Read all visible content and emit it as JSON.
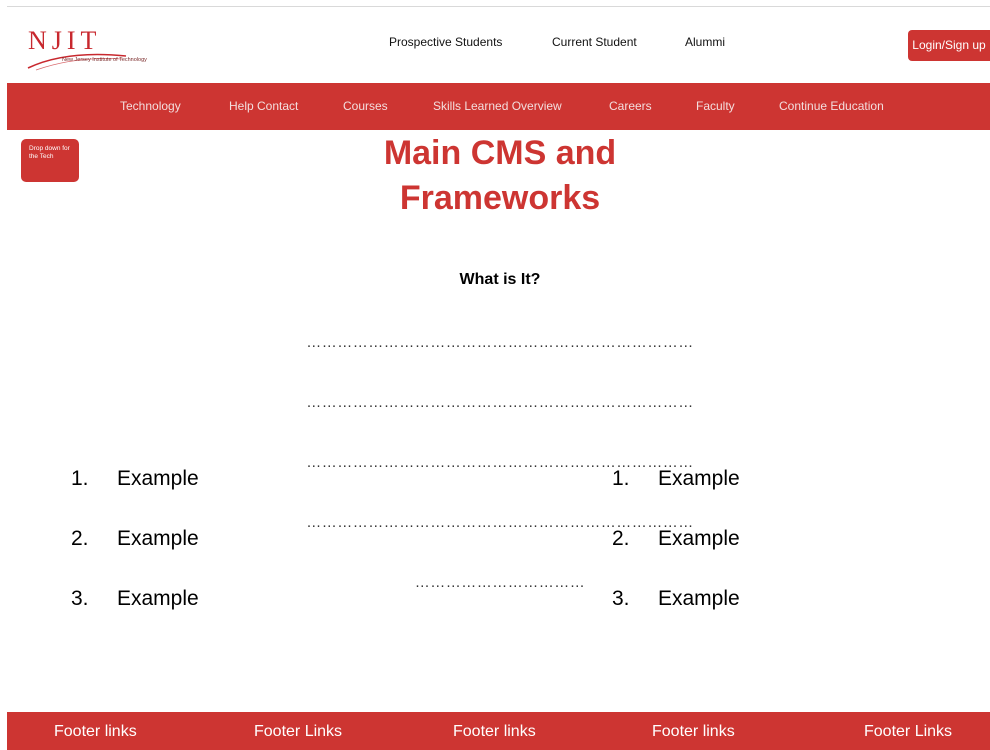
{
  "brand": {
    "logo_text": "NJIT",
    "tagline": "New Jersey Institute of Technology",
    "accent_color": "#cd3532"
  },
  "top_links": [
    "Prospective Students",
    "Current Student",
    "Alummi"
  ],
  "login_label": "Login/Sign up",
  "nav": {
    "items": [
      "Technology",
      "Help Contact",
      "Courses",
      "Skills Learned Overview",
      "Careers",
      "Faculty",
      "Continue Education"
    ]
  },
  "dropdown_label": "Drop down for the Tech",
  "page_title": "Main CMS and Frameworks",
  "section": {
    "heading": "What is It?",
    "placeholder_lines": [
      "…………………………………………………………………",
      "…………………………………………………………………",
      "…………………………………………………………………",
      "…………………………………………………………………",
      "……………………………"
    ]
  },
  "lists": {
    "left": [
      {
        "number": "1.",
        "text": "Example"
      },
      {
        "number": "2.",
        "text": "Example"
      },
      {
        "number": "3.",
        "text": "Example"
      }
    ],
    "right": [
      {
        "number": "1.",
        "text": "Example"
      },
      {
        "number": "2.",
        "text": "Example"
      },
      {
        "number": "3.",
        "text": "Example"
      }
    ]
  },
  "footer": {
    "links": [
      "Footer links",
      "Footer Links",
      "Footer links",
      "Footer links",
      "Footer Links"
    ]
  }
}
